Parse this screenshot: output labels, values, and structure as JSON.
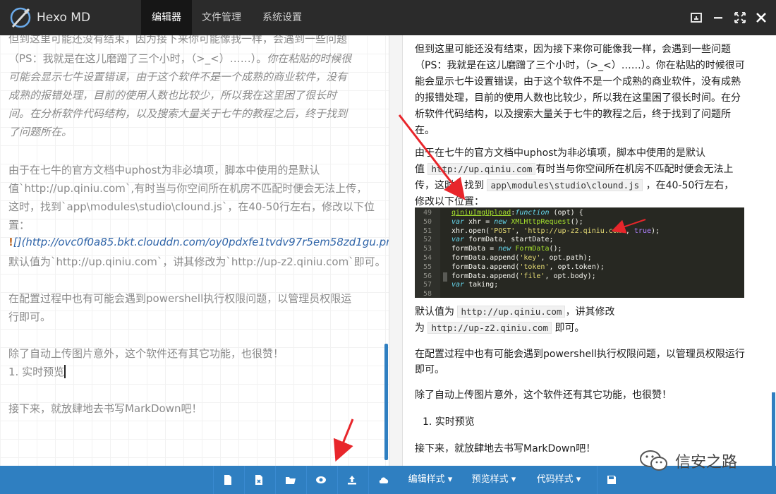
{
  "app": {
    "title": "Hexo MD"
  },
  "tabs": [
    {
      "label": "编辑器",
      "active": true
    },
    {
      "label": "文件管理",
      "active": false
    },
    {
      "label": "系统设置",
      "active": false
    }
  ],
  "window_controls": [
    "restore-icon",
    "minimize-icon",
    "fullscreen-icon",
    "close-icon"
  ],
  "editor": {
    "lines": [
      {
        "text": "但到这里可能还没有结束，因为接下来你可能像我一样，会遇到一些问题",
        "italic": false
      },
      {
        "text": "（PS：我就是在这儿磨蹭了三个小时，（>_<）……）。你在粘贴的时候很",
        "italic_split": "（PS：我就是在这儿磨蹭了三个小时，（>_<）……）。",
        "italic_tail": "你在粘贴的时候很"
      },
      {
        "text": "可能会显示七牛设置错误，由于这个软件不是一个成熟的商业软件，没有",
        "italic": true
      },
      {
        "text": "成熟的报错处理，目前的使用人数也比较少，所以我在这里困了很长时",
        "italic": true
      },
      {
        "text": "间。在分析软件代码结构，以及搜索大量关于七牛的教程之后，终于找到",
        "italic": true
      },
      {
        "text": "了问题所在。",
        "italic": true
      },
      {
        "text": "由于在七牛的官方文档中uphost为非必填项，脚本中使用的是默认",
        "italic": false
      },
      {
        "text": "值`http://up.qiniu.com`,有时当与你空间所在机房不匹配时便会无法上传，",
        "italic": false
      },
      {
        "text": "这时，找到`app\\modules\\studio\\clound.js`，在40-50行左右，修改以下位",
        "italic": false
      },
      {
        "text": "置：",
        "italic": false
      },
      {
        "text_bang": "!",
        "text_bracket": "[]",
        "text_link": "(http://ovc0f0a85.bkt.clouddn.com/oy0pdxfe1tvdv97r5em58zd1gu.png)"
      },
      {
        "text": "默认值为`http://up.qiniu.com`，讲其修改为`http://up-z2.qiniu.com`即可。",
        "italic": false
      },
      {
        "text": "在配置过程中也有可能会遇到powershell执行权限问题，以管理员权限运",
        "italic": false
      },
      {
        "text": "行即可。",
        "italic": false
      },
      {
        "text": "除了自动上传图片意外，这个软件还有其它功能，也很赞！",
        "italic": false
      },
      {
        "text": "1. 实时预览",
        "italic": false
      },
      {
        "text": "接下来，就放肆地去书写MarkDown吧！",
        "italic": false
      }
    ]
  },
  "preview": {
    "p1": [
      "但到这里可能还没有结束，因为接下来你可能像我一样，会遇到一些问题",
      "（PS：我就是在这儿磨蹭了三个小时，（>_<）……）。你在粘贴的时候很可",
      "能会显示七牛设置错误，由于这个软件不是一个成熟的商业软件，没有成熟",
      "的报错处理，目前的使用人数也比较少，所以我在这里困了很长时间。在分",
      "析软件代码结构，以及搜索大量关于七牛的教程之后，终于找到了问题所",
      "在。"
    ],
    "p2_line1": "由于在七牛的官方文档中uphost为非必填项，脚本中使用的是默认",
    "p2_line2_pre": "值",
    "p2_line2_code": "http://up.qiniu.com",
    "p2_line2_post": "有时当与你空间所在机房不匹配时便会无法上",
    "p2_line3_pre": "传，这时，找到",
    "p2_line3_code": "app\\modules\\studio\\clound.js",
    "p2_line3_post": "，在40-50行左右，",
    "p2_line4": "修改以下位置：",
    "code_lines": [
      {
        "n": "49",
        "t": "qiniuImgUpload:function (opt) {"
      },
      {
        "n": "50",
        "t": "    var xhr = new XMLHttpRequest();"
      },
      {
        "n": "51",
        "t": "    xhr.open('POST', 'http://up-z2.qiniu.com', true);"
      },
      {
        "n": "52",
        "t": "    var formData, startDate;"
      },
      {
        "n": "53",
        "t": "    formData = new FormData();"
      },
      {
        "n": "54",
        "t": "    formData.append('key', opt.path);"
      },
      {
        "n": "55",
        "t": "    formData.append('token', opt.token);"
      },
      {
        "n": "56",
        "t": "    formData.append('file', opt.body);"
      },
      {
        "n": "57",
        "t": "    var taking;"
      },
      {
        "n": "58",
        "t": ""
      }
    ],
    "p3_line1_pre": "默认值为",
    "p3_line1_code": "http://up.qiniu.com",
    "p3_line1_post": "，讲其修改",
    "p3_line2_pre": "为",
    "p3_line2_code": "http://up-z2.qiniu.com",
    "p3_line2_post": "即可。",
    "p4": [
      "在配置过程中也有可能会遇到powershell执行权限问题，以管理员权限运行",
      "即可。"
    ],
    "p5": "除了自动上传图片意外，这个软件还有其它功能，也很赞！",
    "list_item": "1.   实时预览",
    "p6": "接下来，就放肆地去书写MarkDown吧！"
  },
  "toolbar": {
    "icons": [
      "new-file-icon",
      "export-file-icon",
      "open-folder-icon",
      "preview-eye-icon",
      "upload-image-icon",
      "cloud-icon"
    ],
    "dropdowns": [
      {
        "label": "编辑样式 ▾"
      },
      {
        "label": "预览样式 ▾"
      },
      {
        "label": "代码样式 ▾"
      }
    ],
    "save_icon": "save-icon"
  },
  "watermark": {
    "text": "信安之路"
  },
  "colors": {
    "topbar": "#2b2b2b",
    "toolbar": "#2f7fc1",
    "arrow": "#e8262b",
    "code_bg": "#272822"
  }
}
